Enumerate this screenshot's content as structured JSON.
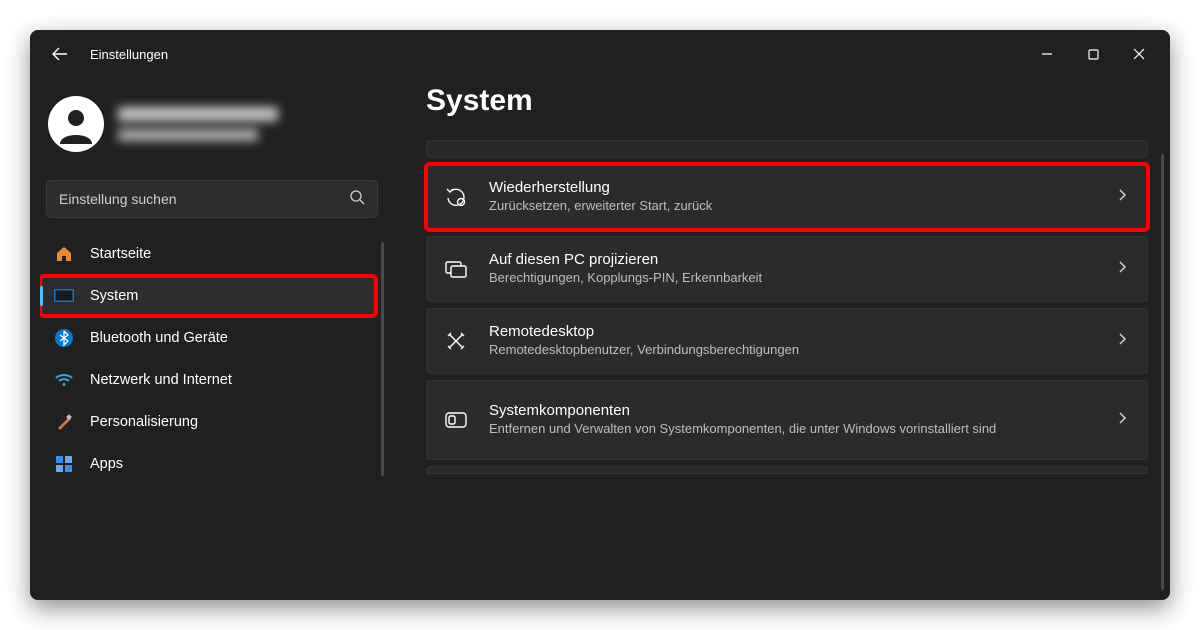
{
  "window": {
    "title": "Einstellungen"
  },
  "search": {
    "placeholder": "Einstellung suchen"
  },
  "sidebar": {
    "items": [
      {
        "label": "Startseite"
      },
      {
        "label": "System"
      },
      {
        "label": "Bluetooth und Geräte"
      },
      {
        "label": "Netzwerk und Internet"
      },
      {
        "label": "Personalisierung"
      },
      {
        "label": "Apps"
      }
    ]
  },
  "page": {
    "heading": "System"
  },
  "cards": [
    {
      "title": "Wiederherstellung",
      "subtitle": "Zurücksetzen, erweiterter Start, zurück"
    },
    {
      "title": "Auf diesen PC projizieren",
      "subtitle": "Berechtigungen, Kopplungs-PIN, Erkennbarkeit"
    },
    {
      "title": "Remotedesktop",
      "subtitle": "Remotedesktopbenutzer, Verbindungsberechtigungen"
    },
    {
      "title": "Systemkomponenten",
      "subtitle": "Entfernen und Verwalten von Systemkomponenten, die unter Windows vorinstalliert sind"
    }
  ],
  "colors": {
    "accent": "#4cc2ff",
    "highlight": "#ff0000"
  }
}
